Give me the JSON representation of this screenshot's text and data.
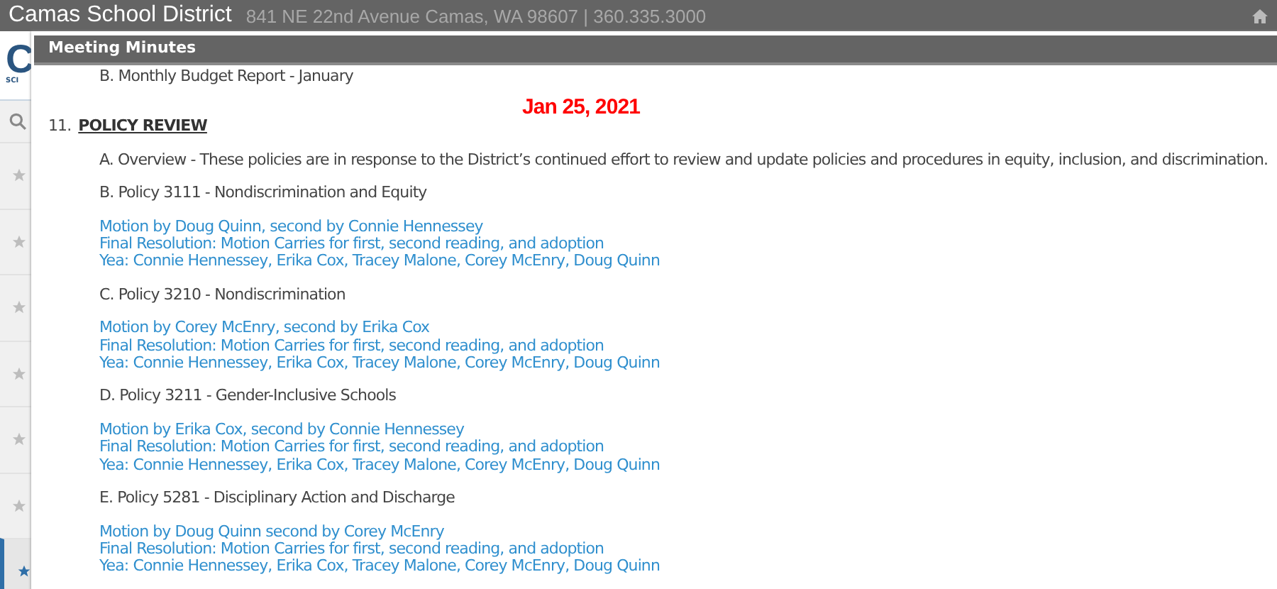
{
  "top_bar": {
    "title": "Camas School District",
    "address": "841 NE 22nd Avenue Camas, WA 98607 | 360.335.3000"
  },
  "background": {
    "logo_text": "C",
    "logo_subtext": "SCI",
    "star_rows": [
      {
        "selected": false
      },
      {
        "selected": false
      },
      {
        "selected": false
      },
      {
        "selected": false
      },
      {
        "selected": false
      },
      {
        "selected": false
      },
      {
        "selected": true
      }
    ]
  },
  "dialog": {
    "title": "Meeting Minutes",
    "date": "Jan 25, 2021",
    "leading_item": "B. Monthly Budget Report - January",
    "section": {
      "number": "11.",
      "title": "POLICY REVIEW"
    },
    "items": [
      {
        "kind": "text",
        "text": "A. Overview - These policies are in response to the District’s continued effort to review and update policies and procedures in equity, inclusion, and discrimination."
      },
      {
        "kind": "policy",
        "text": "B. Policy 3111 - Nondiscrimination and Equity",
        "motion": [
          "Motion by Doug Quinn, second by Connie Hennessey",
          "Final Resolution: Motion Carries for first, second reading, and adoption",
          "Yea: Connie Hennessey, Erika Cox, Tracey Malone, Corey McEnry, Doug Quinn"
        ]
      },
      {
        "kind": "policy",
        "text": "C. Policy 3210 - Nondiscrimination",
        "motion": [
          "Motion by Corey McEnry, second by Erika Cox",
          "Final Resolution: Motion Carries for first, second reading, and adoption",
          "Yea: Connie Hennessey, Erika Cox, Tracey Malone, Corey McEnry, Doug Quinn"
        ]
      },
      {
        "kind": "policy",
        "text": "D. Policy 3211 - Gender-Inclusive Schools",
        "motion": [
          "Motion by Erika Cox, second by Connie Hennessey",
          "Final Resolution: Motion Carries for first, second reading, and adoption",
          "Yea: Connie Hennessey, Erika Cox, Tracey Malone, Corey McEnry, Doug Quinn"
        ]
      },
      {
        "kind": "policy",
        "text": "E. Policy 5281 - Disciplinary Action and Discharge",
        "motion": [
          "Motion by Doug Quinn second by Corey McEnry",
          "Final Resolution: Motion Carries for first, second reading, and adoption",
          "Yea: Connie Hennessey, Erika Cox, Tracey Malone, Corey McEnry, Doug Quinn"
        ]
      }
    ]
  }
}
